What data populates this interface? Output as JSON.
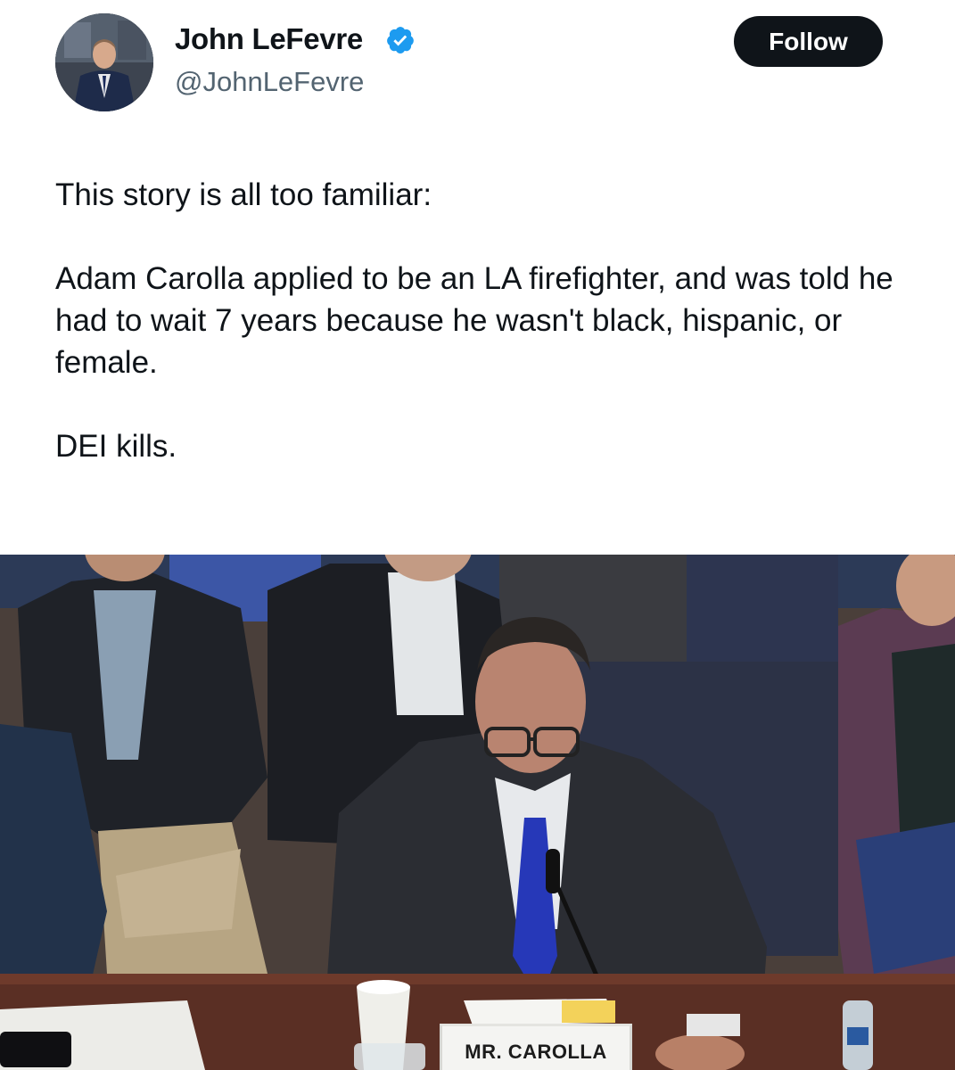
{
  "author": {
    "display_name": "John LeFevre",
    "handle": "@JohnLeFevre",
    "verified_icon": "verified-badge-icon",
    "verified_color": "#1d9bf0"
  },
  "follow_button": {
    "label": "Follow"
  },
  "tweet": {
    "paragraphs": [
      "This story is all too familiar:",
      "Adam Carolla applied to be an LA firefighter, and was told he had to wait 7 years because he wasn't black, hispanic, or female.",
      "DEI kills."
    ]
  },
  "media": {
    "nameplate": "MR. CAROLLA"
  },
  "colors": {
    "text": "#0f1419",
    "secondary_text": "#536471",
    "button_bg": "#0f1419",
    "button_text": "#ffffff"
  }
}
